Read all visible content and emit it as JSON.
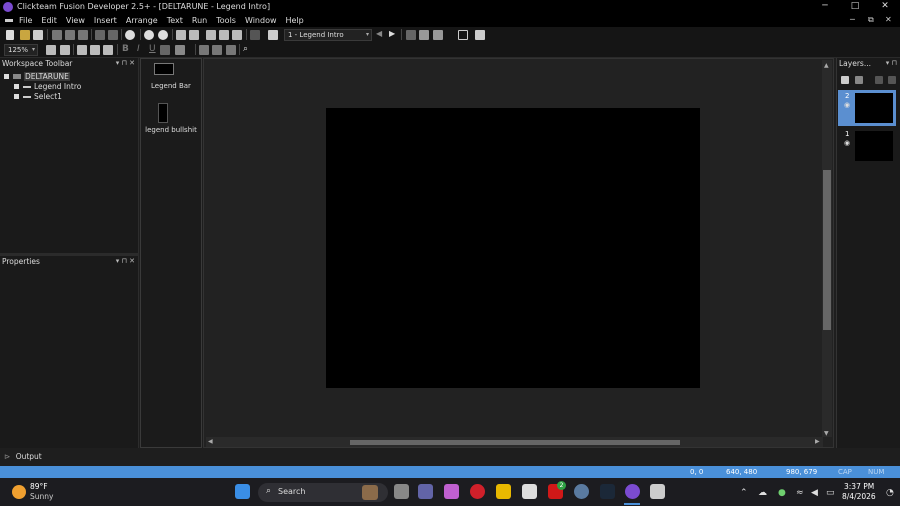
{
  "window": {
    "title": "Clickteam Fusion Developer 2.5+ - [DELTARUNE - Legend Intro]",
    "minimize": "─",
    "maximize": "□",
    "close": "✕"
  },
  "menu": {
    "items": [
      "File",
      "Edit",
      "View",
      "Insert",
      "Arrange",
      "Text",
      "Run",
      "Tools",
      "Window",
      "Help"
    ],
    "mdi_minimize": "─",
    "mdi_restore": "⧉",
    "mdi_close": "✕"
  },
  "toolbar": {
    "frame_selector_value": "1 - Legend Intro",
    "zoom_value": "125%",
    "bold": "B",
    "italic": "I",
    "underline": "U"
  },
  "workspace_toolbar": {
    "title": "Workspace Toolbar",
    "controls": "▾ ⊓ ✕",
    "tree": [
      {
        "label": "DELTARUNE",
        "level": 0,
        "selected": true
      },
      {
        "label": "Legend Intro",
        "level": 1
      },
      {
        "label": "Select1",
        "level": 1
      }
    ]
  },
  "properties_panel": {
    "title": "Properties",
    "controls": "▾ ⊓ ✕"
  },
  "output_tab": {
    "label": "Output"
  },
  "objects": [
    {
      "label": "Legend Bar"
    },
    {
      "label": "legend bullshit"
    }
  ],
  "layers_panel": {
    "title": "Layers...",
    "controls": "▾ ⊓",
    "layers": [
      {
        "number": "2",
        "selected": true
      },
      {
        "number": "1",
        "selected": false
      }
    ]
  },
  "statusbar": {
    "cursor_pos": "0, 0",
    "frame_size": "640, 480",
    "mouse_pos": "980, 679",
    "caps": "CAP",
    "num": "NUM"
  },
  "taskbar": {
    "weather_temp": "89°F",
    "weather_desc": "Sunny",
    "search_placeholder": "Search",
    "time": "3:37 PM",
    "date": "8/4/2026",
    "notification_badge": "2"
  },
  "colors": {
    "accent": "#4a90d9",
    "layer_selected": "#5b8fd0",
    "canvas": "#000000",
    "app_icon": "#7b4bd1"
  }
}
